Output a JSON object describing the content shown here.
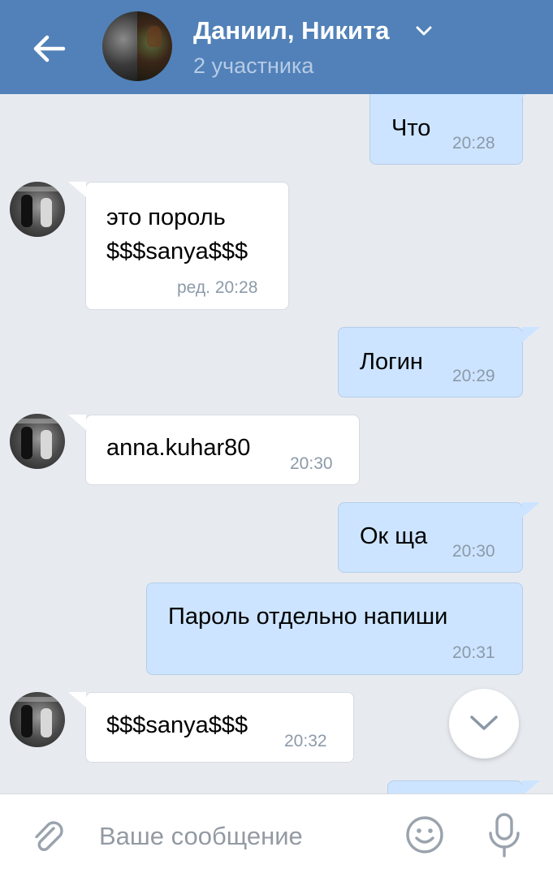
{
  "header": {
    "title": "Даниил, Никита",
    "subtitle": "2 участника",
    "color": "#5181b8"
  },
  "messages": [
    {
      "direction": "out",
      "text": "Что",
      "time": "20:28"
    },
    {
      "direction": "in",
      "lines": [
        "это пороль",
        "$$$sanya$$$"
      ],
      "time": "ред. 20:28"
    },
    {
      "direction": "out",
      "text": "Логин",
      "time": "20:29"
    },
    {
      "direction": "in",
      "text": "anna.kuhar80",
      "time": "20:30"
    },
    {
      "direction": "out",
      "text": "Ок ща",
      "time": "20:30"
    },
    {
      "direction": "out",
      "text": "Пароль отдельно напиши",
      "time": "20:31"
    },
    {
      "direction": "in",
      "text": "$$$sanya$$$",
      "time": "20:32"
    }
  ],
  "input": {
    "placeholder": "Ваше сообщение",
    "value": ""
  },
  "icons": {
    "back": "arrow-left-icon",
    "title_dropdown": "chevron-down-icon",
    "scroll_down": "chevron-down-icon",
    "attach": "paperclip-icon",
    "emoji": "smile-icon",
    "voice": "microphone-icon"
  }
}
